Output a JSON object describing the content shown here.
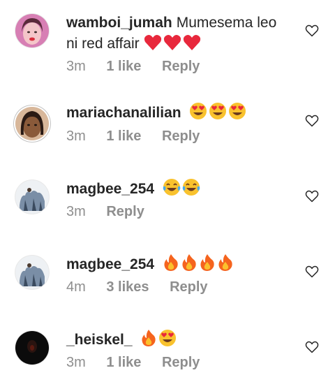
{
  "comments": [
    {
      "username": "wamboi_jumah",
      "text": "Mumesema leo ni red affair",
      "emoji": [
        "red-heart",
        "red-heart",
        "red-heart"
      ],
      "time": "3m",
      "likes": "1 like",
      "reply": "Reply"
    },
    {
      "username": "mariachanalilian",
      "text": "",
      "emoji": [
        "heart-eyes",
        "heart-eyes",
        "heart-eyes"
      ],
      "time": "3m",
      "likes": "1 like",
      "reply": "Reply"
    },
    {
      "username": "magbee_254",
      "text": "",
      "emoji": [
        "tears-of-joy",
        "tears-of-joy"
      ],
      "time": "3m",
      "likes": "",
      "reply": "Reply"
    },
    {
      "username": "magbee_254",
      "text": "",
      "emoji": [
        "fire",
        "fire",
        "fire",
        "fire"
      ],
      "time": "4m",
      "likes": "3 likes",
      "reply": "Reply"
    },
    {
      "username": "_heiskel_",
      "text": "",
      "emoji": [
        "fire",
        "heart-eyes"
      ],
      "time": "3m",
      "likes": "1 like",
      "reply": "Reply"
    }
  ],
  "colors": {
    "text": "#262626",
    "muted": "#8e8e8e",
    "heart_emoji": "#e8283c",
    "heart_eyes_face": "#f9c22e"
  },
  "icons": {
    "like": "heart-outline-icon"
  }
}
